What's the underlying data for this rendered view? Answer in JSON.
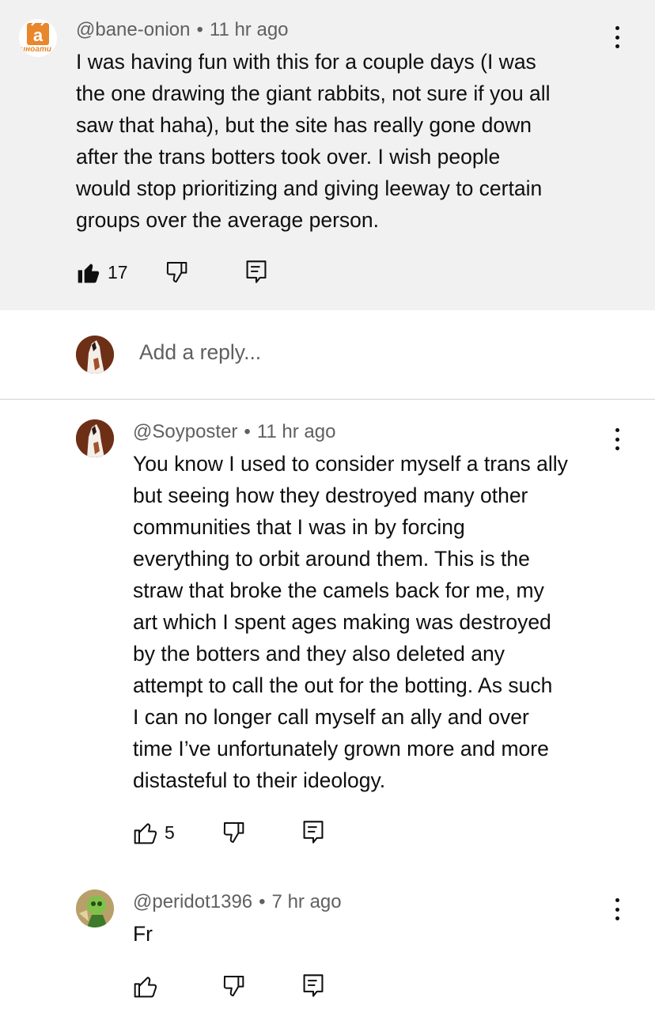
{
  "comment": {
    "author": "@bane-onion",
    "time": "11 hr ago",
    "avatar_text": "иноати",
    "lines": [
      "I was having fun with this for a couple days (I was",
      "the one drawing the giant rabbits, not sure if you all",
      "saw that haha), but the site has really gone down",
      "after the trans botters took over. I wish people",
      "would stop prioritizing and giving leeway to certain",
      "groups over the average person."
    ],
    "likes": "17"
  },
  "reply_box": {
    "placeholder": "Add a reply..."
  },
  "replies": [
    {
      "author": "@Soyposter",
      "time": "11 hr ago",
      "lines": [
        "You know I used to consider myself a trans ally",
        "but seeing how they destroyed many other",
        "communities that I was in by forcing",
        "everything to orbit around them. This is the",
        "straw that broke the camels back for me, my",
        "art which I spent ages making was destroyed",
        "by the botters and they also deleted any",
        "attempt to call the out for the botting. As such",
        "I can no longer call myself an ally and over",
        "time I’ve unfortunately grown more and more",
        "distasteful to their ideology."
      ],
      "likes": "5"
    },
    {
      "author": "@peridot1396",
      "time": "7 hr ago",
      "lines": [
        "Fr"
      ],
      "likes": ""
    }
  ],
  "colors": {
    "top_background": "#f1f1f1",
    "meta_text": "#606060",
    "divider": "#d3d3d3"
  }
}
